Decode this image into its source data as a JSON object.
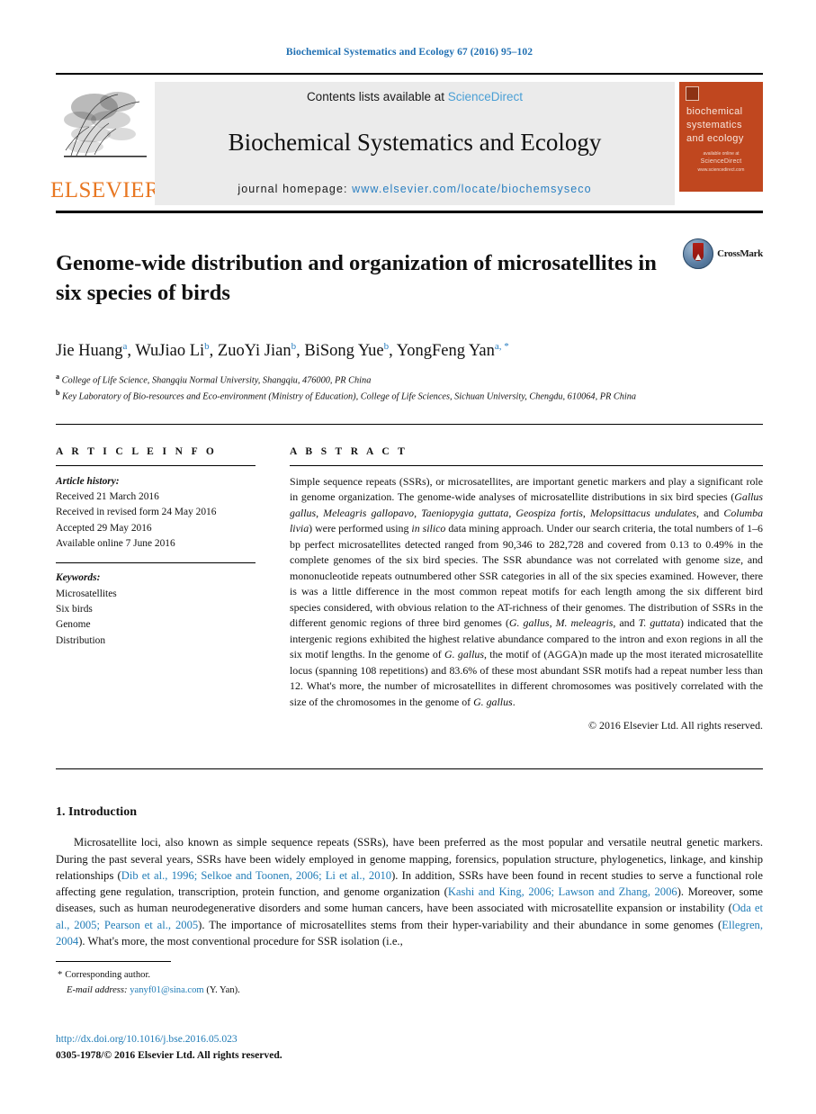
{
  "running_head": "Biochemical Systematics and Ecology 67 (2016) 95–102",
  "masthead": {
    "publisher_word": "ELSEVIER",
    "contents_prefix": "Contents lists available at ",
    "contents_link": "ScienceDirect",
    "journal_name": "Biochemical Systematics and Ecology",
    "homepage_label": "journal homepage: ",
    "homepage_url": "www.elsevier.com/locate/biochemsyseco",
    "cover": {
      "title_line1": "biochemical",
      "title_line2": "systematics",
      "title_line3": "and ecology",
      "foot_small": "available online at",
      "foot_brand": "ScienceDirect",
      "foot_url": "www.sciencedirect.com"
    }
  },
  "article": {
    "title": "Genome-wide distribution and organization of microsatellites in six species of birds",
    "crossmark_label": "CrossMark",
    "authors": [
      {
        "name": "Jie Huang",
        "sup": "a",
        "sep": ", "
      },
      {
        "name": "WuJiao Li",
        "sup": "b",
        "sep": ", "
      },
      {
        "name": "ZuoYi Jian",
        "sup": "b",
        "sep": ", "
      },
      {
        "name": "BiSong Yue",
        "sup": "b",
        "sep": ", "
      },
      {
        "name": "YongFeng Yan",
        "sup": "a, *",
        "sep": ""
      }
    ],
    "affiliations": [
      {
        "mark": "a",
        "text": "College of Life Science, Shangqiu Normal University, Shangqiu, 476000, PR China"
      },
      {
        "mark": "b",
        "text": "Key Laboratory of Bio-resources and Eco-environment (Ministry of Education), College of Life Sciences, Sichuan University, Chengdu, 610064, PR China"
      }
    ]
  },
  "article_info": {
    "heading": "A R T I C L E  I N F O",
    "history_label": "Article history:",
    "history": [
      "Received 21 March 2016",
      "Received in revised form 24 May 2016",
      "Accepted 29 May 2016",
      "Available online 7 June 2016"
    ],
    "keywords_label": "Keywords:",
    "keywords": [
      "Microsatellites",
      "Six birds",
      "Genome",
      "Distribution"
    ]
  },
  "abstract": {
    "heading": "A B S T R A C T",
    "paragraph_html": "Simple sequence repeats (SSRs), or microsatellites, are important genetic markers and play a significant role in genome organization. The genome-wide analyses of microsatellite distributions in six bird species (<i>Gallus gallus</i>, <i>Meleagris gallopavo</i>, <i>Taeniopygia guttata</i>, <i>Geospiza fortis</i>, <i>Melopsittacus undulates</i>, and <i>Columba livia</i>) were performed using <i>in silico</i> data mining approach. Under our search criteria, the total numbers of 1&#8211;6 bp perfect microsatellites detected ranged from 90,346 to 282,728 and covered from 0.13 to 0.49% in the complete genomes of the six bird species. The SSR abundance was not correlated with genome size, and mononucleotide repeats outnumbered other SSR categories in all of the six species examined. However, there is was a little difference in the most common repeat motifs for each length among the six different bird species considered, with obvious relation to the AT-richness of their genomes. The distribution of SSRs in the different genomic regions of three bird genomes (<i>G. gallus</i>, <i>M. meleagris</i>, and <i>T. guttata</i>) indicated that the intergenic regions exhibited the highest relative abundance compared to the intron and exon regions in all the six motif lengths. In the genome of <i>G. gallus</i>, the motif of (AGGA)n made up the most iterated microsatellite locus (spanning 108 repetitions) and 83.6% of these most abundant SSR motifs had a repeat number less than 12. What's more, the number of microsatellites in different chromosomes was positively correlated with the size of the chromosomes in the genome of <i>G. gallus</i>.",
    "copyright": "© 2016 Elsevier Ltd. All rights reserved."
  },
  "introduction": {
    "heading": "1. Introduction",
    "paragraph_html": "<span class=\"indent\"></span>Microsatellite loci, also known as simple sequence repeats (SSRs), have been preferred as the most popular and versatile neutral genetic markers. During the past several years, SSRs have been widely employed in genome mapping, forensics, population structure, phylogenetics, linkage, and kinship relationships (<span class=\"ref\">Dib et al., 1996; Selkoe and Toonen, 2006; Li et al., 2010</span>). In addition, SSRs have been found in recent studies to serve a functional role affecting gene regulation, transcription, protein function, and genome organization (<span class=\"ref\">Kashi and King, 2006; Lawson and Zhang, 2006</span>). Moreover, some diseases, such as human neurodegenerative disorders and some human cancers, have been associated with microsatellite expansion or instability (<span class=\"ref\">Oda et al., 2005; Pearson et al., 2005</span>). The importance of microsatellites stems from their hyper-variability and their abundance in some genomes (<span class=\"ref\">Ellegren, 2004</span>). What's more, the most conventional procedure for SSR isolation (i.e.,"
  },
  "footer": {
    "corresponding_star": "*",
    "corresponding_text": "Corresponding author.",
    "email_label": "E-mail address:",
    "email": "yanyf01@sina.com",
    "email_suffix": "(Y. Yan).",
    "doi": "http://dx.doi.org/10.1016/j.bse.2016.05.023",
    "issn_copyright": "0305-1978/© 2016 Elsevier Ltd. All rights reserved."
  },
  "colors": {
    "link_blue": "#1f7bb6",
    "sciencedirect_blue": "#4a9fd5",
    "elsevier_orange": "#e87722",
    "cover_orange": "#c0471f",
    "band_gray": "#ebebeb"
  }
}
